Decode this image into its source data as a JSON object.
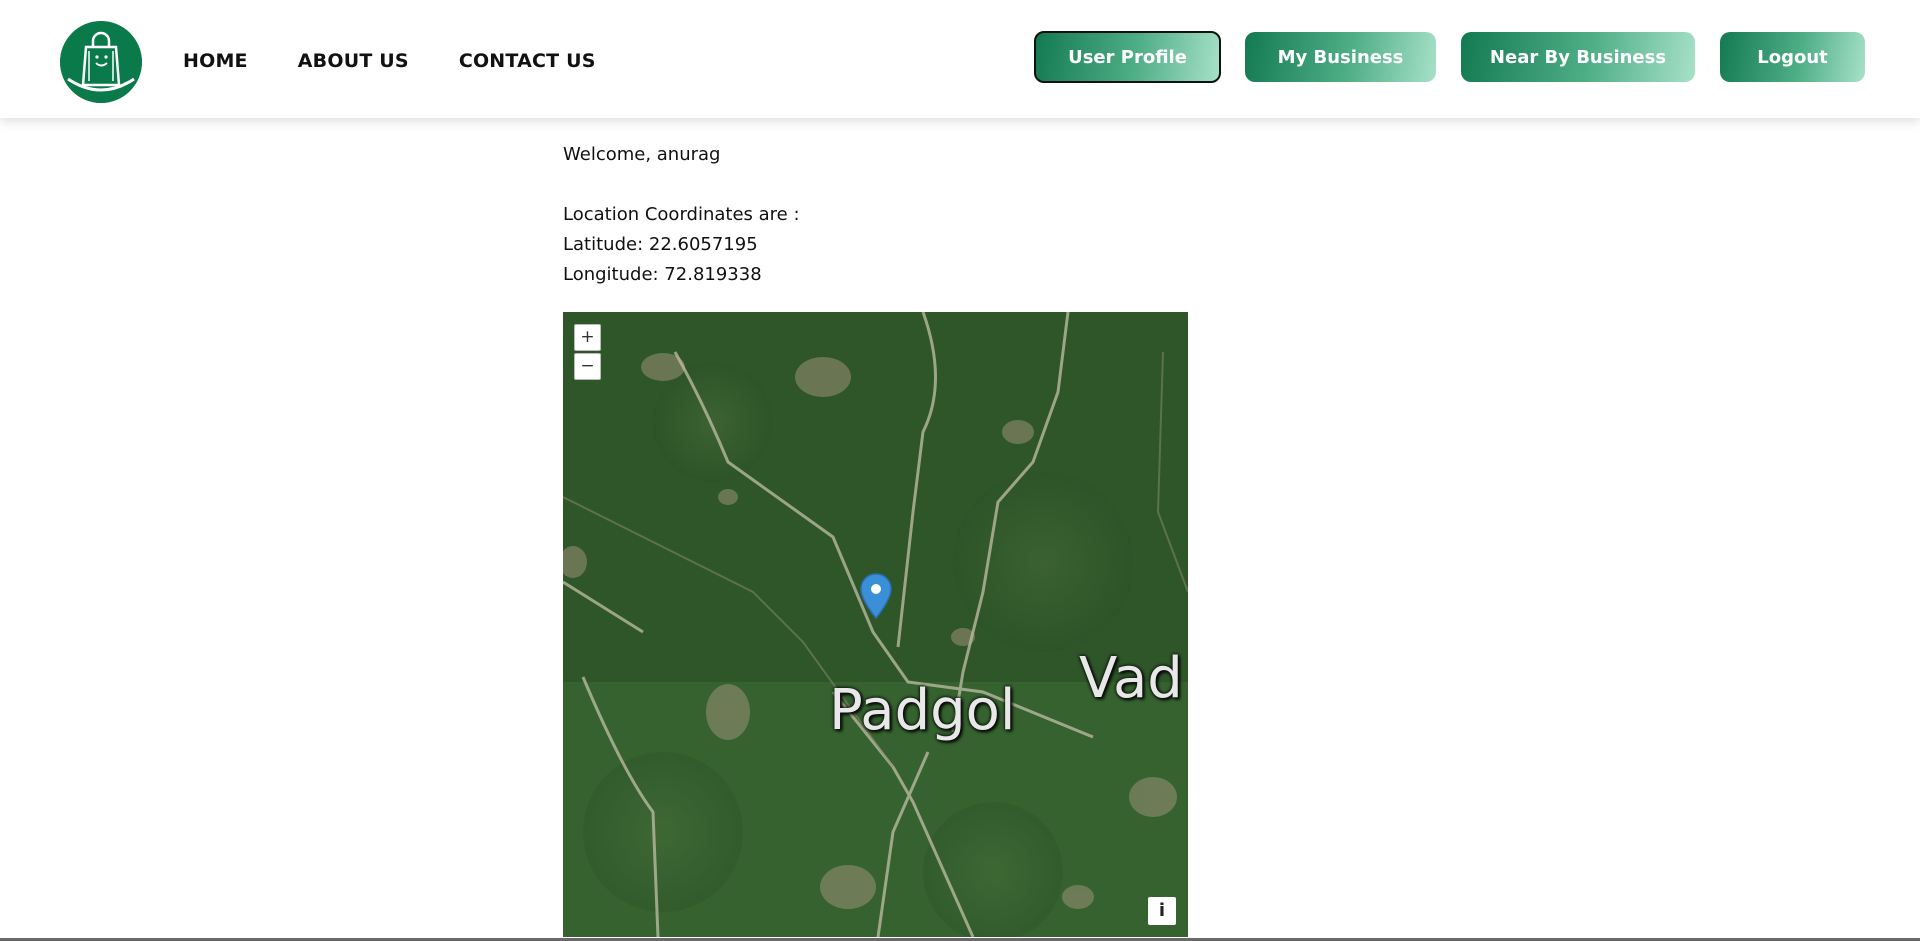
{
  "app": {
    "logo_icon": "shopping-bag-smile-icon",
    "brand_color": "#0b7a4b"
  },
  "nav": {
    "links": [
      "HOME",
      "ABOUT US",
      "CONTACT US"
    ]
  },
  "buttons": {
    "user_profile": "User Profile",
    "my_business": "My Business",
    "near_by_business": "Near By Business",
    "logout": "Logout"
  },
  "content": {
    "welcome": "Welcome, anurag",
    "coords_heading": "Location Coordinates are :",
    "latitude": "Latitude: 22.6057195",
    "longitude": "Longitude: 72.819338"
  },
  "map": {
    "zoom_in": "+",
    "zoom_out": "−",
    "info": "i",
    "labels": [
      "Padgol",
      "Vad"
    ],
    "marker_icon": "map-pin-icon",
    "marker_color": "#3a8fd6"
  }
}
